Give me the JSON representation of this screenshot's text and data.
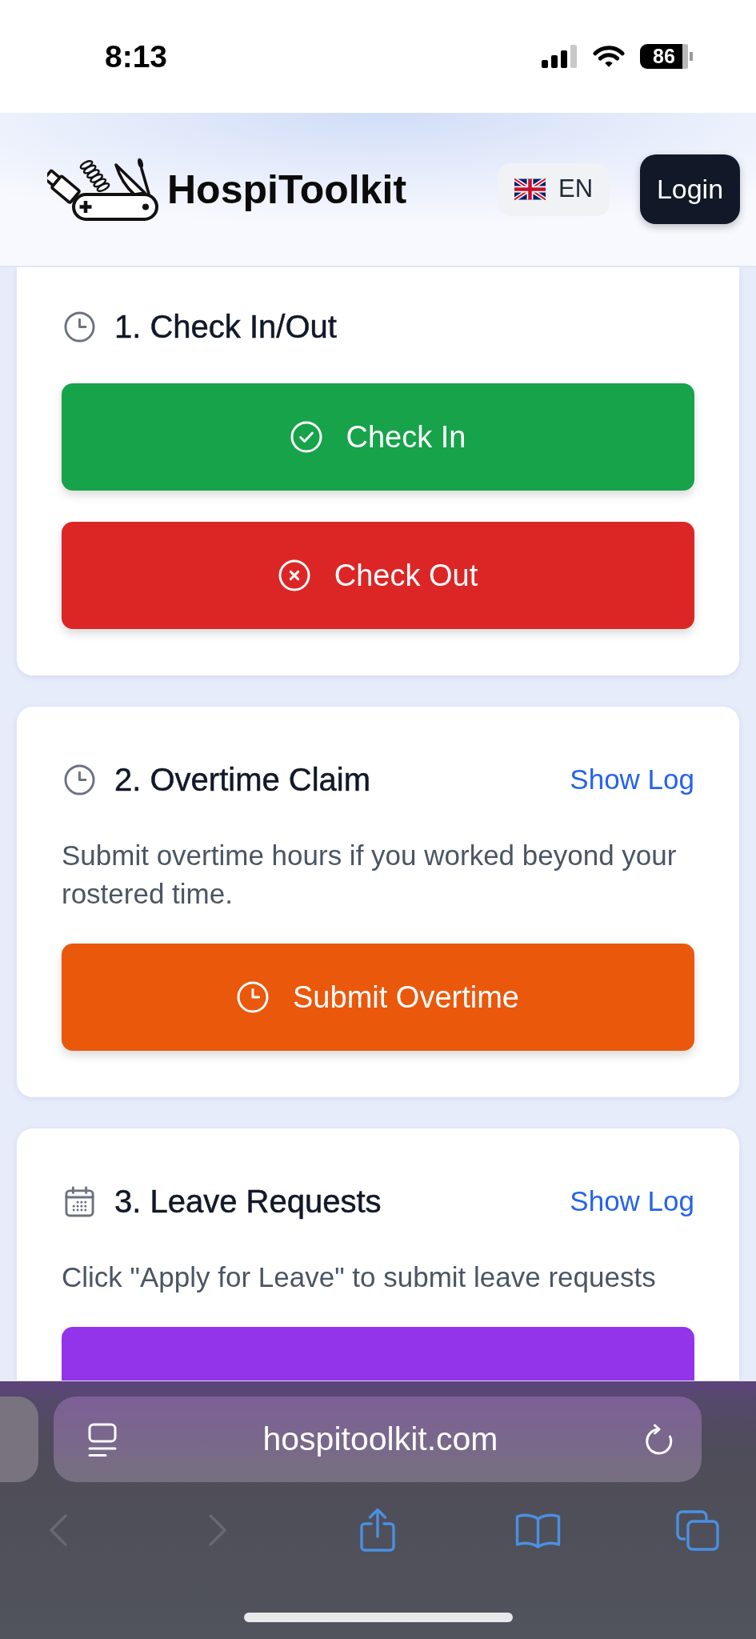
{
  "status_bar": {
    "time": "8:13",
    "battery": "86"
  },
  "header": {
    "brand": "HospiToolkit",
    "language": "EN",
    "login": "Login"
  },
  "sections": [
    {
      "kind": "attendance",
      "title": "1. Check In/Out",
      "buttons": [
        {
          "kind": "check_in",
          "label": "Check In",
          "color": "#16a34a"
        },
        {
          "kind": "check_out",
          "label": "Check Out",
          "color": "#dc2626"
        }
      ]
    },
    {
      "kind": "overtime",
      "title": "2. Overtime Claim",
      "link": "Show Log",
      "description": "Submit overtime hours if you worked beyond your rostered time.",
      "buttons": [
        {
          "kind": "overtime",
          "label": "Submit Overtime",
          "color": "#ea580c"
        }
      ]
    },
    {
      "kind": "leave",
      "title": "3. Leave Requests",
      "link": "Show Log",
      "description": "Click \"Apply for Leave\" to submit leave requests",
      "buttons": [
        {
          "kind": "leave",
          "color": "#9333ea"
        }
      ]
    }
  ],
  "browser": {
    "url": "hospitoolkit.com",
    "toolbar": [
      {
        "kind": "back",
        "disabled": true
      },
      {
        "kind": "forward",
        "disabled": true
      },
      {
        "kind": "share",
        "disabled": false
      },
      {
        "kind": "bookmarks",
        "disabled": false
      },
      {
        "kind": "tabs",
        "disabled": false
      }
    ]
  }
}
